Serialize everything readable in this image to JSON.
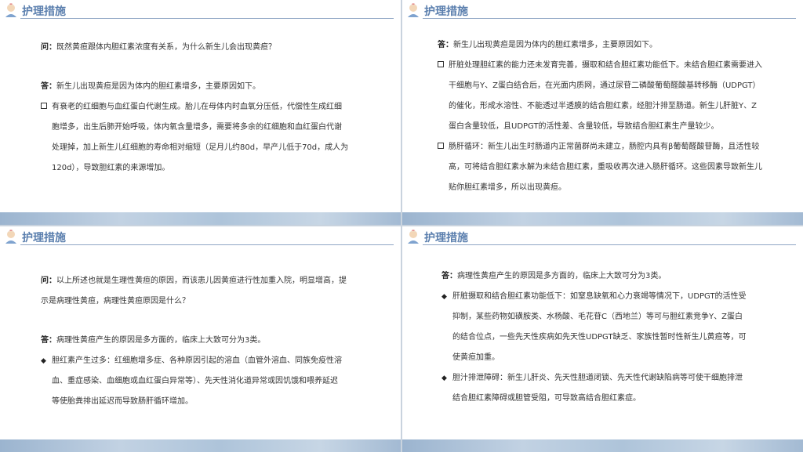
{
  "section_title": "护理措施",
  "slide1": {
    "q_label": "问：",
    "q_text": "既然黄疸跟体内胆红素浓度有关系，为什么新生儿会出现黄疸？",
    "a_label": "答：",
    "a_text": "新生儿出现黄疸是因为体内的胆红素增多，主要原因如下。",
    "bullets": [
      {
        "lines": [
          "有衰老的红细胞与血红蛋白代谢生成。胎儿在母体内时血氧分压低，代偿性生成红细",
          "胞增多，出生后肺开始呼吸，体内氧含量增多，需要将多余的红细胞和血红蛋白代谢",
          "处理掉，加上新生儿红细胞的寿命相对缩短（足月儿约80d，早产儿低于70d，成人为",
          "120d），导致胆红素的来源增加。"
        ]
      }
    ]
  },
  "slide2": {
    "a_label": "答：",
    "a_text": "新生儿出现黄疸是因为体内的胆红素增多，主要原因如下。",
    "bullets": [
      {
        "lines": [
          "肝脏处理胆红素的能力还未发育完善，摄取和结合胆红素功能低下。未结合胆红素需要进入",
          "干细胞与Y、Z蛋白结合后，在光面内质网，通过尿苷二磷酸葡萄醛酸基转移酶（UDPGT）",
          "的催化，形成水溶性、不能透过半透膜的结合胆红素，经胆汁排至肠道。新生儿肝脏Y、Z",
          "蛋白含量较低，且UDPGT的活性差、含量较低，导致结合胆红素生产量较少。"
        ]
      },
      {
        "lines": [
          "肠肝循环：新生儿出生时肠道内正常菌群尚未建立，肠腔内具有β葡萄醛酸苷酶，且活性较",
          "高，可将结合胆红素水解为未结合胆红素，重吸收再次进入肠肝循环。这些因素导致新生儿",
          "贴你胆红素增多，所以出现黄疸。"
        ]
      }
    ]
  },
  "slide3": {
    "q_label": "问：",
    "q_lines": [
      "以上所述也就是生理性黄疸的原因，而该患儿因黄疸进行性加重入院，明显增高，提",
      "示是病理性黄疸，病理性黄疸原因是什么？"
    ],
    "a_label": "答：",
    "a_text": "病理性黄疸产生的原因是多方面的，临床上大致可分为3类。",
    "bullets": [
      {
        "lines": [
          "胆红素产生过多：红细胞增多症、各种原因引起的溶血（血管外溶血、同族免疫性溶",
          "血、重症感染、血细胞或血红蛋白异常等）、先天性消化道异常或因饥饿和喂养延迟",
          "等使胎粪排出延迟而导致肠肝循环增加。"
        ]
      }
    ]
  },
  "slide4": {
    "a_label": "答：",
    "a_text": "病理性黄疸产生的原因是多方面的，临床上大致可分为3类。",
    "bullets": [
      {
        "lines": [
          "肝脏摄取和结合胆红素功能低下：如窒息缺氧和心力衰竭等情况下，UDPGT的活性受",
          "抑制，某些药物如磺胺类、水杨酸、毛花苷C（西地兰）等可与胆红素竞争Y、Z蛋白",
          "的结合位点，一些先天性疾病如先天性UDPGT缺乏、家族性暂时性新生儿黄疸等，可",
          "使黄疸加重。"
        ]
      },
      {
        "lines": [
          "胆汁排泄障碍：新生儿肝炎、先天性胆道闭锁、先天性代谢缺陷病等可使干细胞排泄",
          "结合胆红素障碍或胆管受阻，可导致高结合胆红素症。"
        ]
      }
    ]
  }
}
